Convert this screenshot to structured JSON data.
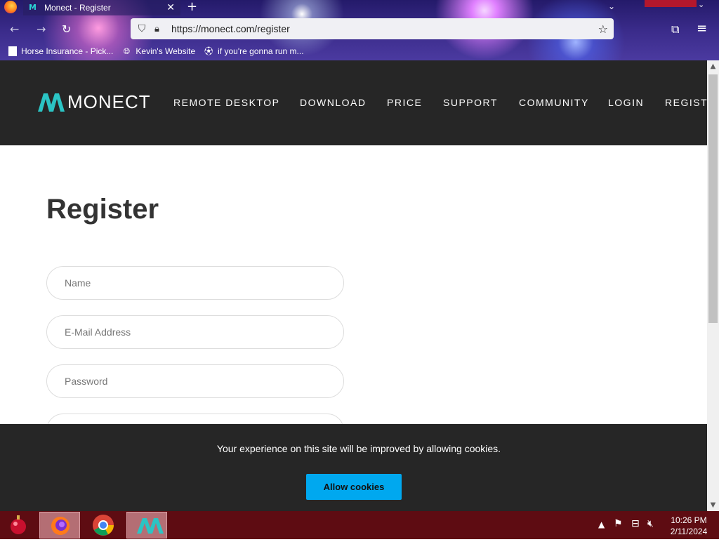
{
  "browser": {
    "tab": {
      "title": "Monect - Register",
      "favicon": "monect-favicon-icon"
    },
    "url": "https://monect.com/register",
    "bookmarks": [
      {
        "label": "Horse Insurance - Pick...",
        "icon": "page-icon"
      },
      {
        "label": "Kevin's Website",
        "icon": "globe-icon"
      },
      {
        "label": "if you're gonna run m...",
        "icon": "soccer-ball-icon"
      }
    ]
  },
  "site": {
    "logo_text": "MONECT",
    "nav": [
      "REMOTE DESKTOP",
      "DOWNLOAD",
      "PRICE",
      "SUPPORT",
      "COMMUNITY",
      "LOGIN",
      "REGIST"
    ],
    "page_title": "Register",
    "form": {
      "name_placeholder": "Name",
      "email_placeholder": "E-Mail Address",
      "password_placeholder": "Password"
    },
    "cookie": {
      "message": "Your experience on this site will be improved by allowing cookies.",
      "button": "Allow cookies"
    }
  },
  "taskbar": {
    "time": "10:26 PM",
    "date": "2/11/2024",
    "apps": [
      "firefox",
      "chrome",
      "monect"
    ]
  },
  "colors": {
    "accent": "#00a8ef",
    "header": "#262626",
    "taskbar": "#5e0c12",
    "logo": "#2bc4c4"
  }
}
